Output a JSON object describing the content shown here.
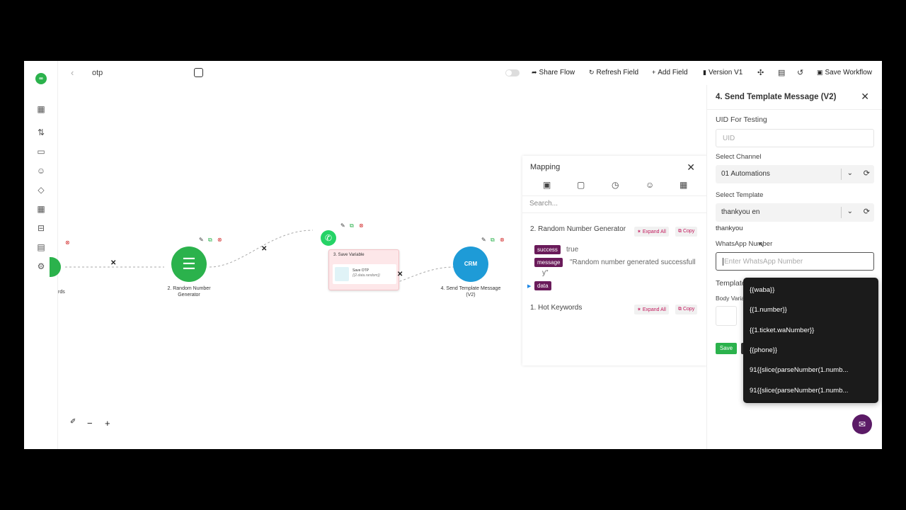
{
  "topbar": {
    "flow_name": "otp",
    "share_flow": "Share Flow",
    "refresh_field": "Refresh Field",
    "add_field": "Add Field",
    "version": "Version V1",
    "save_workflow": "Save Workflow"
  },
  "canvas": {
    "nodes": {
      "hot_keywords_label": "rds",
      "random_number_label_1": "2. Random Number",
      "random_number_label_2": "Generator",
      "save_variable_header": "3. Save Variable",
      "save_variable_title": "Save OTP",
      "save_variable_expr": "{{2.data.random}}",
      "send_template_label_1": "4. Send Template Message",
      "send_template_label_2": "(V2)",
      "crm_text": "CRM"
    },
    "zoom": {
      "magic": "✐",
      "minus": "−",
      "plus": "+"
    }
  },
  "mapping": {
    "title": "Mapping",
    "search_placeholder": "Search...",
    "section_random": "2. Random Number Generator",
    "section_hot": "1. Hot Keywords",
    "expand_all": "Expand All",
    "copy": "Copy",
    "fields": {
      "success_key": "success",
      "success_val": "true",
      "message_key": "message",
      "message_val_1": "\"Random number generated successfull",
      "message_val_2": "y\"",
      "data_key": "data"
    }
  },
  "rpanel": {
    "title": "4. Send Template Message (V2)",
    "uid_label": "UID For Testing",
    "uid_placeholder": "UID",
    "channel_label": "Select Channel",
    "channel_value": "01 Automations",
    "template_label": "Select Template",
    "template_value": "thankyou en",
    "template_name": "thankyou",
    "whatsapp_label": "WhatsApp Number",
    "whatsapp_placeholder": "Enter WhatsApp Number",
    "template_partial": "Template",
    "body_partial": "Body Varia",
    "save": "Save"
  },
  "dropdown": {
    "items": [
      "{{waba}}",
      "{{1.number}}",
      "{{1.ticket.waNumber}}",
      "{{phone}}",
      "91{{slice(parseNumber(1.numb...",
      "91{{slice(parseNumber(1.numb..."
    ]
  },
  "colors": {
    "accent_green": "#2bb24c",
    "crm_blue": "#1e9bd7",
    "tag_purple": "#6a1b5a",
    "chat_purple": "#5b1a66"
  }
}
